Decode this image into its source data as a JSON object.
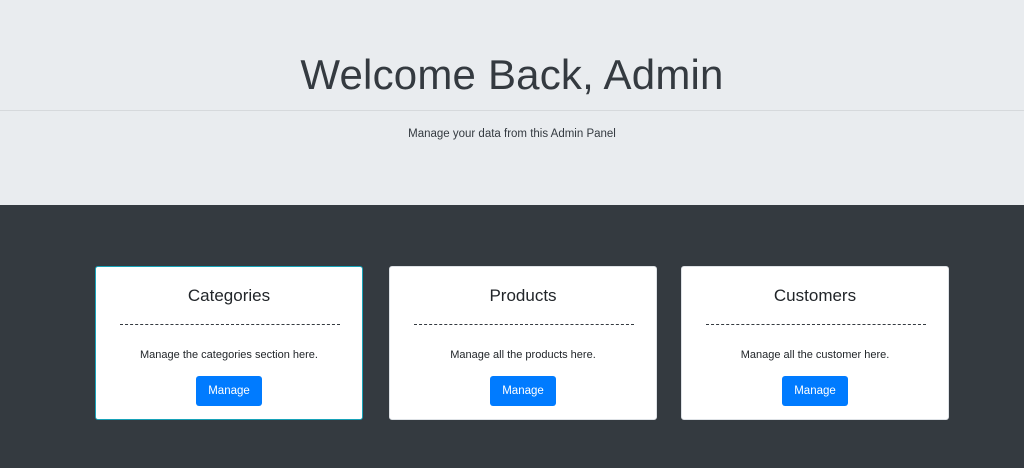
{
  "hero": {
    "title": "Welcome Back, Admin",
    "subtitle": "Manage your data from this Admin Panel"
  },
  "cards": [
    {
      "title": "Categories",
      "text": "Manage the categories section here.",
      "button_label": "Manage",
      "active": true
    },
    {
      "title": "Products",
      "text": "Manage all the products here.",
      "button_label": "Manage",
      "active": false
    },
    {
      "title": "Customers",
      "text": "Manage all the customer here.",
      "button_label": "Manage",
      "active": false
    }
  ],
  "colors": {
    "hero_bg": "#e9ecef",
    "dark_bg": "#343a40",
    "button_bg": "#007bff",
    "active_border": "#17a2b8"
  }
}
